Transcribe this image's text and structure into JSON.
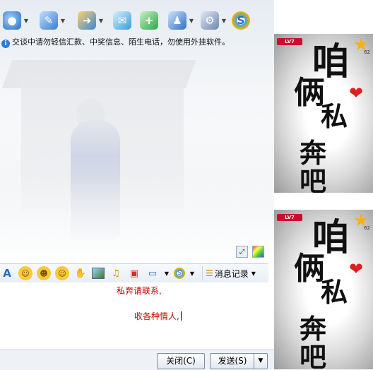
{
  "notice": {
    "text": "交谈中请勿轻信汇款、中奖信息、陌生电话，勿使用外挂软件。"
  },
  "toolbar": {
    "icons": [
      "video-icon",
      "voice-icon",
      "file-transfer-icon",
      "screenshot-icon",
      "add-app-icon",
      "profile-icon",
      "settings-icon",
      "soso-icon"
    ]
  },
  "format_toolbar": {
    "message_record_label": "消息记录"
  },
  "input": {
    "line1": "私奔请联系,",
    "line2": "收各种情人,"
  },
  "buttons": {
    "close": "关闭(C)",
    "send": "发送(S)"
  },
  "profile_cards": [
    {
      "level": "LV7",
      "star_count": "62",
      "lines": [
        "咱",
        "俩",
        "私",
        "奔",
        "吧"
      ]
    },
    {
      "level": "LV7",
      "star_count": "62",
      "lines": [
        "咱",
        "俩",
        "私",
        "奔",
        "吧"
      ]
    }
  ],
  "colors": {
    "message_text": "#c00000",
    "heart": "#e02020",
    "star": "#f4b400",
    "info_icon": "#2f7bd8"
  }
}
